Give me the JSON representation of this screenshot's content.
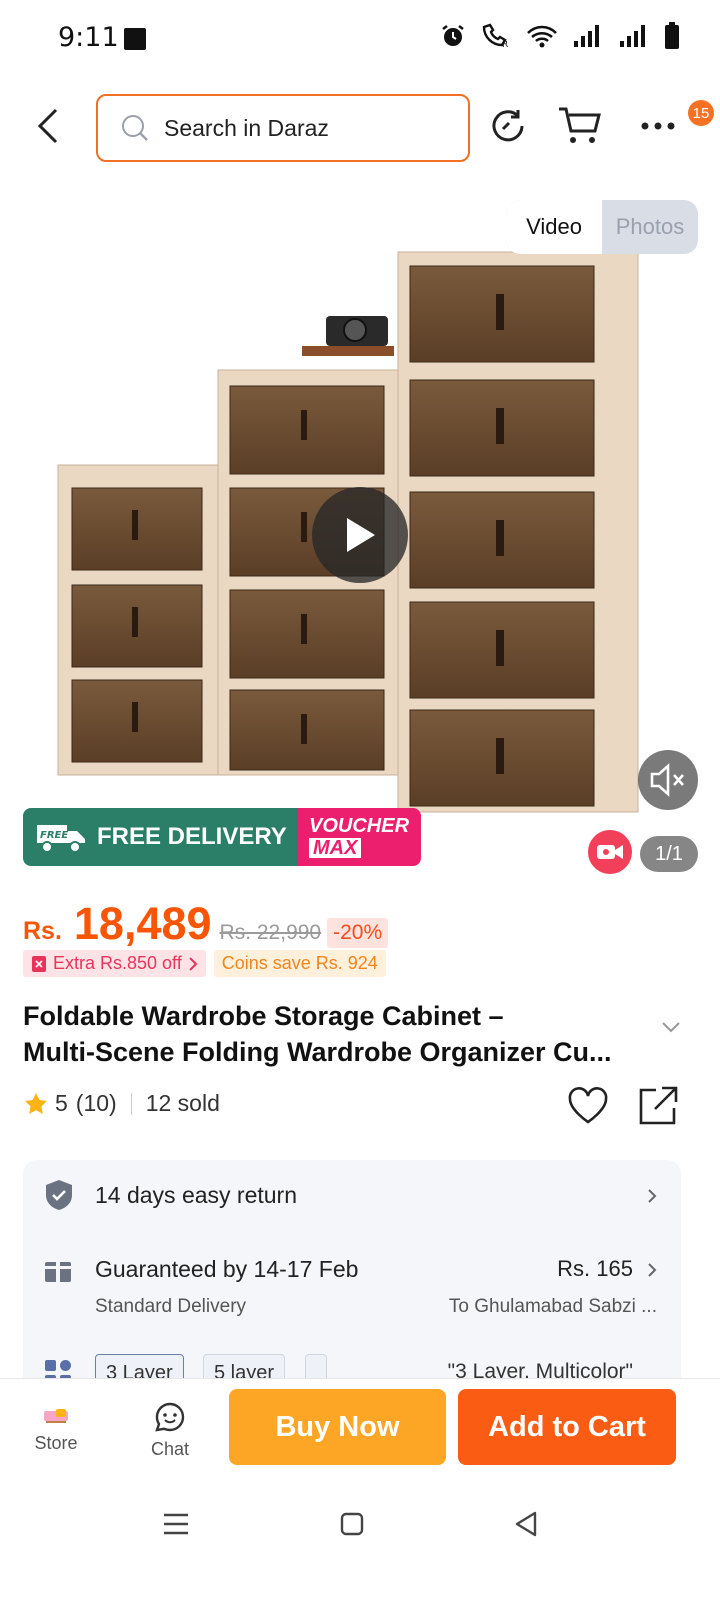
{
  "status_bar": {
    "time": "9:11"
  },
  "search": {
    "placeholder": "Search in Daraz"
  },
  "header": {
    "more_badge": "15"
  },
  "media": {
    "tab_video": "Video",
    "tab_photos": "Photos",
    "active_tab": "Video",
    "counter": "1/1",
    "promo_free_delivery": "FREE DELIVERY",
    "promo_free_small": "FREE",
    "promo_voucher": "VOUCHER",
    "promo_max": "MAX"
  },
  "price": {
    "currency": "Rs.",
    "current": "18,489",
    "original": "Rs. 22,990",
    "discount": "-20%"
  },
  "promotions": {
    "extra_off": "Extra Rs.850 off",
    "coins_save": "Coins save Rs. 924"
  },
  "product": {
    "title_line1": "Foldable Wardrobe Storage Cabinet –",
    "title_line2": "Multi-Scene Folding Wardrobe Organizer Cu..."
  },
  "rating": {
    "score": "5",
    "count": "(10)",
    "sold": "12 sold"
  },
  "info": {
    "return_policy": "14 days easy return",
    "delivery_guarantee": "Guaranteed by 14-17 Feb",
    "delivery_type": "Standard Delivery",
    "delivery_fee": "Rs. 165",
    "delivery_location": "To Ghulamabad Sabzi ...",
    "variant_chip_1": "3 Layer",
    "variant_chip_2": "5 layer",
    "selected_variant": "\"3 Layer, Multicolor\""
  },
  "actions": {
    "store": "Store",
    "chat": "Chat",
    "buy_now": "Buy Now",
    "add_to_cart": "Add to Cart"
  },
  "colors": {
    "brand_orange": "#f85606",
    "buy_now": "#fda524",
    "add_to_cart": "#fa5c13",
    "free_delivery_green": "#2b7e68",
    "voucher_pink": "#ec1f6e"
  }
}
